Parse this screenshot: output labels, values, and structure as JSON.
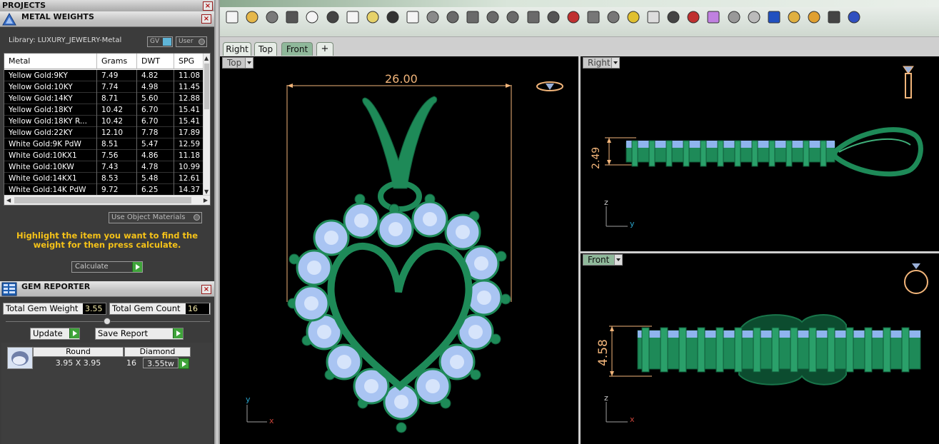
{
  "panels": {
    "projects_title": "PROJECTS",
    "metal_title": "METAL WEIGHTS",
    "gem_title": "GEM REPORTER"
  },
  "metal": {
    "library_label": "Library: LUXURY_JEWELRY-Metal",
    "gv_label": "GV",
    "user_label": "User",
    "columns": [
      "Metal",
      "Grams",
      "DWT",
      "SPG"
    ],
    "rows": [
      [
        "Yellow Gold:9KY",
        "7.49",
        "4.82",
        "11.08"
      ],
      [
        "Yellow Gold:10KY",
        "7.74",
        "4.98",
        "11.45"
      ],
      [
        "Yellow Gold:14KY",
        "8.71",
        "5.60",
        "12.88"
      ],
      [
        "Yellow Gold:18KY",
        "10.42",
        "6.70",
        "15.41"
      ],
      [
        "Yellow Gold:18KY R...",
        "10.42",
        "6.70",
        "15.41"
      ],
      [
        "Yellow Gold:22KY",
        "12.10",
        "7.78",
        "17.89"
      ],
      [
        "White Gold:9K PdW",
        "8.51",
        "5.47",
        "12.59"
      ],
      [
        "White Gold:10KX1",
        "7.56",
        "4.86",
        "11.18"
      ],
      [
        "White Gold:10KW",
        "7.43",
        "4.78",
        "10.99"
      ],
      [
        "White Gold:14KX1",
        "8.53",
        "5.48",
        "12.61"
      ],
      [
        "White Gold:14K PdW",
        "9.72",
        "6.25",
        "14.37"
      ]
    ],
    "use_object_materials": "Use Object Materials",
    "instruction": "Highlight the item you want to find the weight for then press calculate.",
    "calculate_label": "Calculate"
  },
  "gem": {
    "total_weight_label": "Total Gem Weight",
    "total_weight_value": "3.55",
    "total_count_label": "Total Gem Count",
    "total_count_value": "16",
    "update_label": "Update",
    "save_report_label": "Save Report",
    "shape_header": "Round",
    "type_header": "Diamond",
    "size": "3.95 X 3.95",
    "count": "16",
    "tw": "3.55tw"
  },
  "view_tabs": [
    "Right",
    "Top",
    "Front"
  ],
  "viewports": {
    "top_label": "Top",
    "right_label": "Right",
    "front_label": "Front",
    "top_dimension": "26.00",
    "right_dimension": "2.49",
    "front_dimension": "4.58",
    "axis_x": "x",
    "axis_y": "y",
    "axis_z": "z"
  },
  "colors": {
    "metal_green": "#1f8a5a",
    "gem_blue": "#a9c4f2",
    "dimension_orange": "#f2b57a",
    "accent_yellow": "#f5c218"
  },
  "toolbar_icons": [
    "new-icon",
    "open-icon",
    "save-icon",
    "print-icon",
    "export-icon",
    "cut-icon",
    "copy-icon",
    "paste-icon",
    "undo-icon",
    "pan-hand-icon",
    "move-icon",
    "zoom-in-icon",
    "zoom-window-icon",
    "zoom-extents-icon",
    "zoom-target-icon",
    "rotate-view-icon",
    "four-view-icon",
    "car-icon",
    "plane-icon",
    "timer-icon",
    "snap-icon",
    "light-icon",
    "lock-icon",
    "material-icon",
    "color-wheel-icon",
    "shade-icon",
    "render-icon",
    "sphere-icon",
    "spotlight-icon",
    "settings-gear-icon",
    "dimension-icon",
    "help-icon"
  ]
}
